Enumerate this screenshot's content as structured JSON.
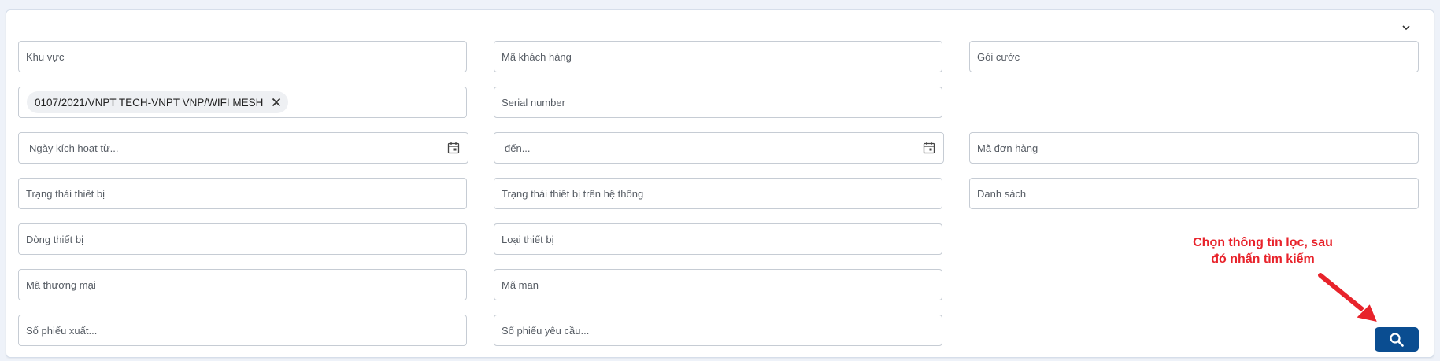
{
  "fields": {
    "khu_vuc": {
      "placeholder": "Khu vực",
      "value": ""
    },
    "ma_khach_hang": {
      "placeholder": "Mã khách hàng",
      "value": ""
    },
    "goi_cuoc": {
      "placeholder": "Gói cước",
      "value": ""
    },
    "contract_chip": {
      "label": "0107/2021/VNPT TECH-VNPT VNP/WIFI MESH"
    },
    "serial_number": {
      "placeholder": "Serial number",
      "value": ""
    },
    "ngay_kich_hoat_tu": {
      "placeholder": "Ngày kích hoạt từ...",
      "value": ""
    },
    "den": {
      "placeholder": "đến...",
      "value": ""
    },
    "ma_don_hang": {
      "placeholder": "Mã đơn hàng",
      "value": ""
    },
    "trang_thai_thiet_bi": {
      "placeholder": "Trạng thái thiết bị",
      "value": ""
    },
    "trang_thai_he_thong": {
      "placeholder": "Trạng thái thiết bị trên hệ thống",
      "value": ""
    },
    "danh_sach": {
      "placeholder": "Danh sách",
      "value": ""
    },
    "dong_thiet_bi": {
      "placeholder": "Dòng thiết bị",
      "value": ""
    },
    "loai_thiet_bi": {
      "placeholder": "Loại thiết bị",
      "value": ""
    },
    "ma_thuong_mai": {
      "placeholder": "Mã thương mại",
      "value": ""
    },
    "ma_man": {
      "placeholder": "Mã man",
      "value": ""
    },
    "so_phieu_xuat": {
      "placeholder": "Số phiếu xuất...",
      "value": ""
    },
    "so_phieu_yeu_cau": {
      "placeholder": "Số phiếu yêu cầu...",
      "value": ""
    }
  },
  "annotation": {
    "line1": "Chọn thông tin lọc, sau",
    "line2": "đó nhấn tìm kiếm"
  },
  "icons": {
    "collapse": "chevron-down-icon",
    "calendar": "calendar-icon",
    "chip_remove": "close-icon",
    "search": "search-icon"
  },
  "colors": {
    "primary_button": "#0a4d91",
    "annotation": "#e8232b",
    "border": "#c6ccd4"
  }
}
